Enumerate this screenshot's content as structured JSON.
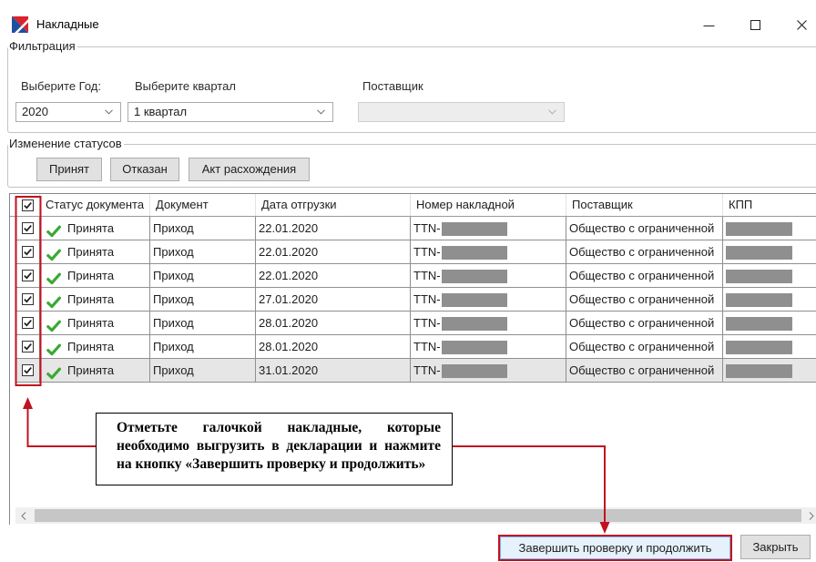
{
  "window": {
    "title": "Накладные",
    "icon": "app-logo-icon",
    "controls": {
      "minimize": "minimize-icon",
      "maximize": "maximize-icon",
      "close": "close-icon"
    }
  },
  "filter": {
    "group_label": "Фильтрация",
    "year": {
      "label": "Выберите Год:",
      "value": "2020"
    },
    "quarter": {
      "label": "Выберите квартал",
      "value": "1 квартал"
    },
    "supplier": {
      "label": "Поставщик",
      "value": "",
      "disabled": true
    }
  },
  "status_change": {
    "group_label": "Изменение статусов",
    "buttons": {
      "accept": "Принят",
      "reject": "Отказан",
      "discrepancy_act": "Акт расхождения"
    }
  },
  "grid": {
    "select_all_checked": true,
    "columns": {
      "status": "Статус документа",
      "document": "Документ",
      "date": "Дата отгрузки",
      "number": "Номер накладной",
      "supplier": "Поставщик",
      "kpp": "КПП"
    },
    "rows": [
      {
        "checked": true,
        "status_icon": "check-icon",
        "status": "Принята",
        "document": "Приход",
        "date": "22.01.2020",
        "number": "TTN-",
        "number_redacted": true,
        "supplier": "Общество с ограниченной",
        "kpp_redacted": true,
        "selected": false
      },
      {
        "checked": true,
        "status_icon": "check-icon",
        "status": "Принята",
        "document": "Приход",
        "date": "22.01.2020",
        "number": "TTN-",
        "number_redacted": true,
        "supplier": "Общество с ограниченной",
        "kpp_redacted": true,
        "selected": false
      },
      {
        "checked": true,
        "status_icon": "check-icon",
        "status": "Принята",
        "document": "Приход",
        "date": "22.01.2020",
        "number": "TTN-",
        "number_redacted": true,
        "supplier": "Общество с ограниченной",
        "kpp_redacted": true,
        "selected": false
      },
      {
        "checked": true,
        "status_icon": "check-icon",
        "status": "Принята",
        "document": "Приход",
        "date": "27.01.2020",
        "number": "TTN-",
        "number_redacted": true,
        "supplier": "Общество с ограниченной",
        "kpp_redacted": true,
        "selected": false
      },
      {
        "checked": true,
        "status_icon": "check-icon",
        "status": "Принята",
        "document": "Приход",
        "date": "28.01.2020",
        "number": "TTN-",
        "number_redacted": true,
        "supplier": "Общество с ограниченной",
        "kpp_redacted": true,
        "selected": false
      },
      {
        "checked": true,
        "status_icon": "check-icon",
        "status": "Принята",
        "document": "Приход",
        "date": "28.01.2020",
        "number": "TTN-",
        "number_redacted": true,
        "supplier": "Общество с ограниченной",
        "kpp_redacted": true,
        "selected": false
      },
      {
        "checked": true,
        "status_icon": "check-icon",
        "status": "Принята",
        "document": "Приход",
        "date": "31.01.2020",
        "number": "TTN-",
        "number_redacted": true,
        "supplier": "Общество с ограниченной",
        "kpp_redacted": true,
        "selected": true
      }
    ]
  },
  "annotation": {
    "lines": [
      "Отметьте галочкой накладные, которые",
      "необходимо выгрузить в декларации и нажмите",
      "на кнопку «Завершить проверку и продолжить»"
    ]
  },
  "footer": {
    "finish_button": "Завершить проверку и продолжить",
    "close_button": "Закрыть"
  },
  "colors": {
    "annotation_red": "#c1121f",
    "status_green": "#3aa935",
    "selected_row_bg": "#e6e6e6",
    "focused_button_bg": "#e5f1fb",
    "redaction_grey": "#8f8f8f"
  },
  "icons": {
    "dropdown": "chevron-down-icon",
    "scroll_left": "chevron-left-icon",
    "scroll_right": "chevron-right-icon",
    "status_accepted": "check-icon"
  }
}
